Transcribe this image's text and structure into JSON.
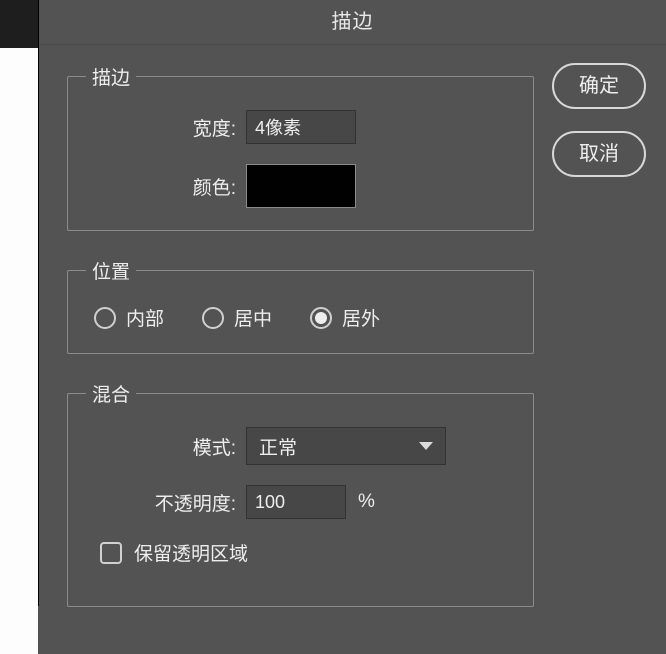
{
  "title": "描边",
  "buttons": {
    "ok": "确定",
    "cancel": "取消"
  },
  "stroke": {
    "legend": "描边",
    "width_label": "宽度:",
    "width_value": "4像素",
    "color_label": "颜色:",
    "color_value": "#010101"
  },
  "position": {
    "legend": "位置",
    "options": [
      {
        "label": "内部",
        "selected": false
      },
      {
        "label": "居中",
        "selected": false
      },
      {
        "label": "居外",
        "selected": true
      }
    ]
  },
  "blend": {
    "legend": "混合",
    "mode_label": "模式:",
    "mode_value": "正常",
    "opacity_label": "不透明度:",
    "opacity_value": "100",
    "opacity_unit": "%",
    "preserve_transparency_label": "保留透明区域",
    "preserve_transparency_checked": false
  }
}
